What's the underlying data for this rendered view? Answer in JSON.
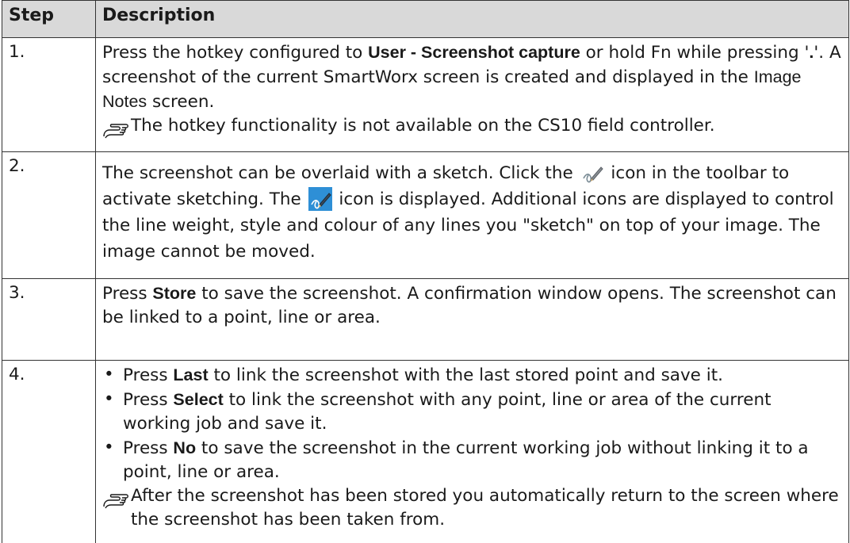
{
  "table": {
    "headers": {
      "step": "Step",
      "description": "Description"
    },
    "rows": [
      {
        "step": "1.",
        "text_a": "Press the hotkey configured to ",
        "bold_a": "User - Screenshot capture",
        "text_b": " or hold Fn while pressing '",
        "bold_b": ".",
        "text_c": "'. A screenshot of the current SmartWorx screen is created and displayed in the ",
        "soft_a": "Image Notes",
        "text_d": " screen.",
        "note": "The hotkey functionality is not available on the CS10 field controller."
      },
      {
        "step": "2.",
        "text_a": "The screenshot can be overlaid with a sketch. Click the ",
        "text_b": " icon in the toolbar to activate sketching. The ",
        "text_c": " icon is displayed. Additional icons are displayed to control the line weight, style and colour of any lines you \"sketch\" on top of your image. The image cannot be moved.",
        "icon_inactive": "sketch-pen-icon",
        "icon_active": "sketch-pen-active-icon"
      },
      {
        "step": "3.",
        "text_a": "Press ",
        "bold_a": "Store",
        "text_b": " to save the screenshot. A confirmation window opens. The screenshot can be linked to a point, line or area."
      },
      {
        "step": "4.",
        "bullets": [
          {
            "pre": "Press ",
            "bold": "Last",
            "post": " to link the screenshot with the last stored point and save it."
          },
          {
            "pre": "Press ",
            "bold": "Select",
            "post": " to link the screenshot with any point, line or area of the current working job and save it."
          },
          {
            "pre": "Press ",
            "bold": "No",
            "post": " to save the screenshot in the current working job without linking it to a point, line or area."
          }
        ],
        "note": "After the screenshot has been stored you automatically return to the screen where the screenshot has been taken from."
      }
    ]
  },
  "colors": {
    "header_bg": "#d9d9d9",
    "border": "#333333",
    "active_icon": "#2e8fd6"
  }
}
